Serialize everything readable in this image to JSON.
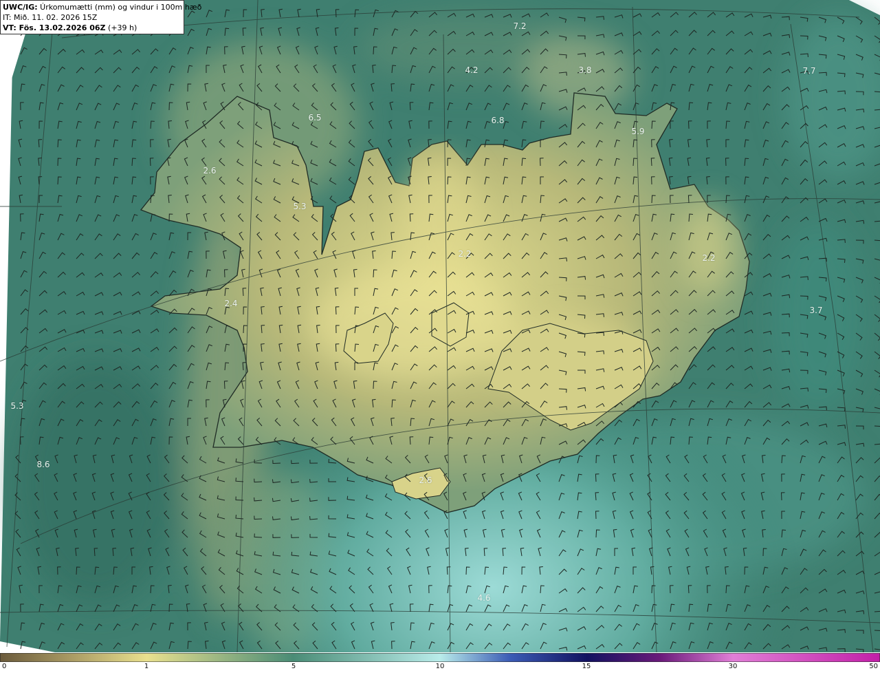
{
  "header": {
    "line1_bold": "UWC/IG:",
    "line1_text": " Úrkomumætti (mm) og vindur i 100m hæð",
    "line2": "IT: Mið. 11. 02. 2026 15Z",
    "line3_bold": "VT: Fös. 13.02.2026 06Z",
    "line3_text": " (+39 h)"
  },
  "colorbar": {
    "ticks": [
      "0",
      "1",
      "5",
      "10",
      "15",
      "30",
      "50"
    ],
    "colors": [
      "#6b5b3c",
      "#a99a63",
      "#e9e08e",
      "#4a8c76",
      "#b9ecea",
      "#2a2a9a",
      "#121260",
      "#6a1a7a",
      "#e07ed6",
      "#c21fa8"
    ]
  },
  "value_labels": [
    "7.2",
    "4.2",
    "3.8",
    "7.7",
    "6.5",
    "6.8",
    "5.9",
    "2.6",
    "5.3",
    "2.2",
    "2.2",
    "2.4",
    "3.7",
    "5.3",
    "8.6",
    "2.6",
    "4.6"
  ],
  "colors": {
    "ocean": "#3e7f72",
    "land": "#c6c27a",
    "coast": "#1e2a24"
  }
}
